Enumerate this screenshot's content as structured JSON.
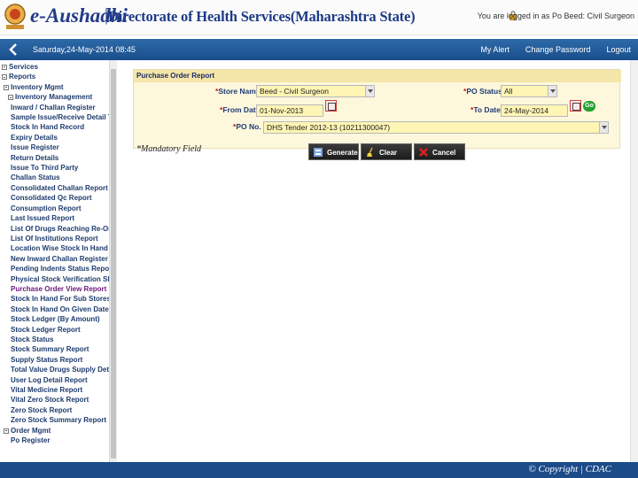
{
  "header": {
    "brand": "e-Aushadhi",
    "department": "Directorate of Health Services(Maharashtra State)",
    "login_info": "You are logged in as Po Beed: Civil Surgeon"
  },
  "navbar": {
    "datetime": "Saturday,24-May-2014 08:45",
    "links": [
      "My Alert",
      "Change Password",
      "Logout"
    ]
  },
  "sidebar": {
    "items": [
      {
        "label": "Services",
        "level": 0,
        "expander": true
      },
      {
        "label": "Reports",
        "level": 0,
        "expander": true
      },
      {
        "label": "Inventory Mgmt",
        "level": 1,
        "expander": true
      },
      {
        "label": "Inventory Management",
        "level": 2,
        "expander": true
      },
      {
        "label": "Inward / Challan Register",
        "level": 3
      },
      {
        "label": "Sample Issue/Receive Detail To",
        "level": 3
      },
      {
        "label": "Stock In Hand Record",
        "level": 3
      },
      {
        "label": "Expiry Details",
        "level": 3
      },
      {
        "label": "Issue Register",
        "level": 3
      },
      {
        "label": "Return Details",
        "level": 3
      },
      {
        "label": "Issue To Third Party",
        "level": 3
      },
      {
        "label": "Challan Status",
        "level": 3
      },
      {
        "label": "Consolidated Challan Report",
        "level": 3
      },
      {
        "label": "Consolidated Qc Report",
        "level": 3
      },
      {
        "label": "Consumption Report",
        "level": 3
      },
      {
        "label": "Last Issued Report",
        "level": 3
      },
      {
        "label": "List Of Drugs Reaching Re-Order",
        "level": 3
      },
      {
        "label": "List Of Institutions Report",
        "level": 3
      },
      {
        "label": "Location Wise Stock In Hand Rep",
        "level": 3
      },
      {
        "label": "New Inward Challan Register",
        "level": 3
      },
      {
        "label": "Pending Indents Status Report",
        "level": 3
      },
      {
        "label": "Physical Stock Verification Sheet",
        "level": 3
      },
      {
        "label": "Purchase Order View Report",
        "level": 3,
        "active": true
      },
      {
        "label": "Stock In Hand For Sub Stores",
        "level": 3
      },
      {
        "label": "Stock In Hand On Given Date",
        "level": 3
      },
      {
        "label": "Stock Ledger (By Amount)",
        "level": 3
      },
      {
        "label": "Stock Ledger Report",
        "level": 3
      },
      {
        "label": "Stock Status",
        "level": 3
      },
      {
        "label": "Stock Summary Report",
        "level": 3
      },
      {
        "label": "Supply Status Report",
        "level": 3
      },
      {
        "label": "Total Value Drugs Supply Detail",
        "level": 3
      },
      {
        "label": "User Log Detail Report",
        "level": 3
      },
      {
        "label": "Vital Medicine Report",
        "level": 3
      },
      {
        "label": "Vital Zero Stock Report",
        "level": 3
      },
      {
        "label": "Zero Stock Report",
        "level": 3
      },
      {
        "label": "Zero Stock Summary Report",
        "level": 3
      },
      {
        "label": "Order Mgmt",
        "level": 1,
        "expander": true
      },
      {
        "label": "Po Register",
        "level": 3
      }
    ]
  },
  "form": {
    "title": "Purchase Order Report",
    "store_name": {
      "label": "Store Name",
      "value": "Beed - Civil Surgeon"
    },
    "po_status": {
      "label": "PO Status",
      "value": "All"
    },
    "from_date": {
      "label": "From Date",
      "value": "01-Nov-2013"
    },
    "to_date": {
      "label": "To Date",
      "value": "24-May-2014"
    },
    "go_label": "Go",
    "po_no": {
      "label": "PO No.",
      "value": "DHS Tender 2012-13 (10211300047)"
    },
    "mandatory_note": "*Mandatory Field",
    "buttons": [
      "Generate",
      "Clear",
      "Cancel"
    ]
  },
  "footer": {
    "copyright": "© Copyright | CDAC"
  }
}
